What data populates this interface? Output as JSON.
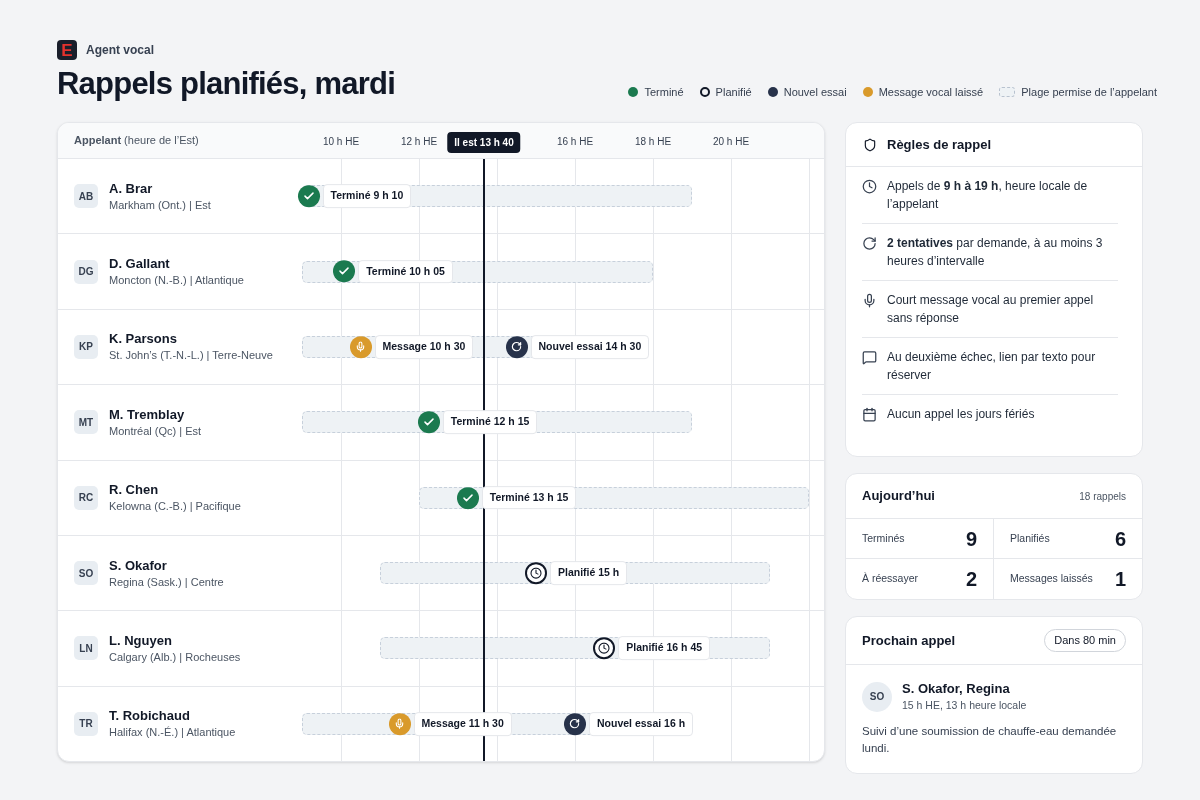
{
  "brand": {
    "logo_letter": "E",
    "name": "Agent vocal"
  },
  "title": "Rappels planifiés, mardi",
  "legend": [
    {
      "kind": "done",
      "label": "Terminé"
    },
    {
      "kind": "scheduled",
      "label": "Planifié"
    },
    {
      "kind": "retry",
      "label": "Nouvel essai"
    },
    {
      "kind": "voicemail",
      "label": "Message vocal laissé"
    },
    {
      "kind": "window",
      "label": "Plage permise de l’appelant"
    }
  ],
  "schedule": {
    "column_header": "**Appelant** (heure de l’Est)",
    "ticks": [
      "10 h HE",
      "12 h HE",
      "16 h HE",
      "18 h HE",
      "20 h HE"
    ],
    "now_label": "Il est 13 h 40",
    "rows": [
      {
        "initials": "AB",
        "name": "A. Brar",
        "place": "Markham (Ont.) | Est",
        "events": [
          {
            "kind": "done",
            "label": "Terminé 9 h 10"
          }
        ]
      },
      {
        "initials": "DG",
        "name": "D. Gallant",
        "place": "Moncton (N.-B.) | Atlantique",
        "events": [
          {
            "kind": "done",
            "label": "Terminé 10 h 05"
          }
        ]
      },
      {
        "initials": "KP",
        "name": "K. Parsons",
        "place": "St. John’s (T.-N.-L.) | Terre-Neuve",
        "events": [
          {
            "kind": "voicemail",
            "label": "Message 10 h 30"
          },
          {
            "kind": "retry",
            "label": "Nouvel essai 14 h 30"
          }
        ]
      },
      {
        "initials": "MT",
        "name": "M. Tremblay",
        "place": "Montréal (Qc) | Est",
        "events": [
          {
            "kind": "done",
            "label": "Terminé 12 h 15"
          }
        ]
      },
      {
        "initials": "RC",
        "name": "R. Chen",
        "place": "Kelowna (C.-B.) | Pacifique",
        "events": [
          {
            "kind": "done",
            "label": "Terminé 13 h 15"
          }
        ]
      },
      {
        "initials": "SO",
        "name": "S. Okafor",
        "place": "Regina (Sask.) | Centre",
        "events": [
          {
            "kind": "scheduled",
            "label": "Planifié 15 h"
          }
        ]
      },
      {
        "initials": "LN",
        "name": "L. Nguyen",
        "place": "Calgary (Alb.) | Rocheuses",
        "events": [
          {
            "kind": "scheduled",
            "label": "Planifié 16 h 45"
          }
        ]
      },
      {
        "initials": "TR",
        "name": "T. Robichaud",
        "place": "Halifax (N.-É.) | Atlantique",
        "events": [
          {
            "kind": "voicemail",
            "label": "Message 11 h 30"
          },
          {
            "kind": "retry",
            "label": "Nouvel essai 16 h"
          }
        ]
      }
    ]
  },
  "rules": {
    "title": "Règles de rappel",
    "items": [
      {
        "kind": "hours",
        "text": "Appels de **9 h à 19 h**, heure locale de l’appelant"
      },
      {
        "kind": "attempts",
        "text": "**2 tentatives** par demande, à au moins 3 heures d’intervalle"
      },
      {
        "kind": "voicemail",
        "text": "Court message vocal au premier appel sans réponse"
      },
      {
        "kind": "text",
        "text": "Au deuxième échec, lien par texto pour réserver"
      },
      {
        "kind": "holidays",
        "text": "Aucun appel les jours fériés"
      }
    ]
  },
  "today": {
    "title": "Aujourd’hui",
    "count": "18 rappels",
    "stats": [
      {
        "label": "Terminés",
        "value": "9"
      },
      {
        "label": "Planifiés",
        "value": "6"
      },
      {
        "label": "À réessayer",
        "value": "2"
      },
      {
        "label": "Messages laissés",
        "value": "1"
      }
    ]
  },
  "next_call": {
    "title": "Prochain appel",
    "badge": "Dans 80 min",
    "initials": "SO",
    "name": "S. Okafor, Regina",
    "time": "15 h HE, 13 h heure locale",
    "note": "Suivi d’une soumission de chauffe-eau demandée lundi."
  }
}
